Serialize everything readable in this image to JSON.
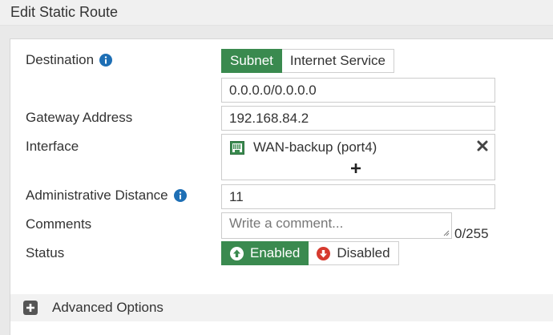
{
  "window": {
    "title": "Edit Static Route"
  },
  "form": {
    "destination": {
      "label": "Destination",
      "options": [
        "Subnet",
        "Internet Service"
      ],
      "selected": "Subnet",
      "value": "0.0.0.0/0.0.0.0"
    },
    "gateway": {
      "label": "Gateway Address",
      "value": "192.168.84.2"
    },
    "interface": {
      "label": "Interface",
      "value": "WAN-backup (port4)",
      "add_label": "+"
    },
    "admin_distance": {
      "label": "Administrative Distance",
      "value": "11"
    },
    "comments": {
      "label": "Comments",
      "placeholder": "Write a comment...",
      "counter": "0/255"
    },
    "status": {
      "label": "Status",
      "enabled_label": "Enabled",
      "disabled_label": "Disabled",
      "selected": "Enabled"
    }
  },
  "advanced": {
    "label": "Advanced Options"
  },
  "colors": {
    "accent_green": "#3a8a4f",
    "info_blue": "#1e6fb5",
    "disabled_red": "#d63a2f"
  },
  "icons": {
    "info": "info-circle-icon",
    "port": "ethernet-port-icon",
    "remove": "close-icon",
    "add": "plus-icon",
    "enabled": "arrow-up-circle-icon",
    "disabled": "arrow-down-circle-icon",
    "advanced": "plus-square-icon"
  }
}
